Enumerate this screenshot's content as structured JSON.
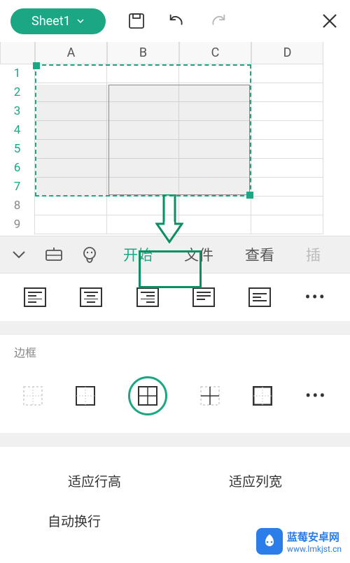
{
  "topBar": {
    "sheetName": "Sheet1"
  },
  "columns": [
    "A",
    "B",
    "C",
    "D"
  ],
  "rows": [
    "1",
    "2",
    "3",
    "4",
    "5",
    "6",
    "7",
    "8",
    "9"
  ],
  "selection": {
    "range": "A1:C7",
    "activeCell": "A1"
  },
  "tabs": {
    "start": "开始",
    "file": "文件",
    "view": "查看",
    "truncated": "插"
  },
  "borderSection": {
    "label": "边框"
  },
  "fitOptions": {
    "fitRowHeight": "适应行高",
    "fitColWidth": "适应列宽",
    "autoWrap": "自动换行"
  },
  "watermark": {
    "title": "蓝莓安卓网",
    "url": "www.lmkjst.cn"
  }
}
